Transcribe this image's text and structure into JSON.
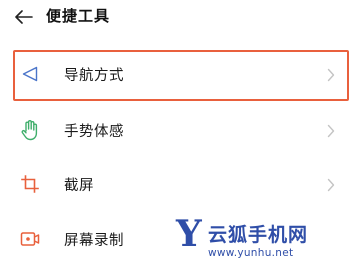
{
  "header": {
    "title": "便捷工具",
    "back_icon": "arrow-left-icon"
  },
  "items": [
    {
      "label": "导航方式",
      "icon": "navigation-triangle-icon",
      "icon_color": "#4a74c9",
      "highlighted": true
    },
    {
      "label": "手势体感",
      "icon": "hand-gesture-icon",
      "icon_color": "#3fae6b",
      "highlighted": false
    },
    {
      "label": "截屏",
      "icon": "crop-icon",
      "icon_color": "#e8603c",
      "highlighted": false
    },
    {
      "label": "屏幕录制",
      "icon": "screen-record-icon",
      "icon_color": "#e8603c",
      "highlighted": false
    }
  ],
  "highlight_color": "#e9603d",
  "watermark": {
    "logo_letter": "Y",
    "brand": "云狐手机网",
    "url": "www.yunhu.net",
    "color": "#2f4ea8"
  }
}
